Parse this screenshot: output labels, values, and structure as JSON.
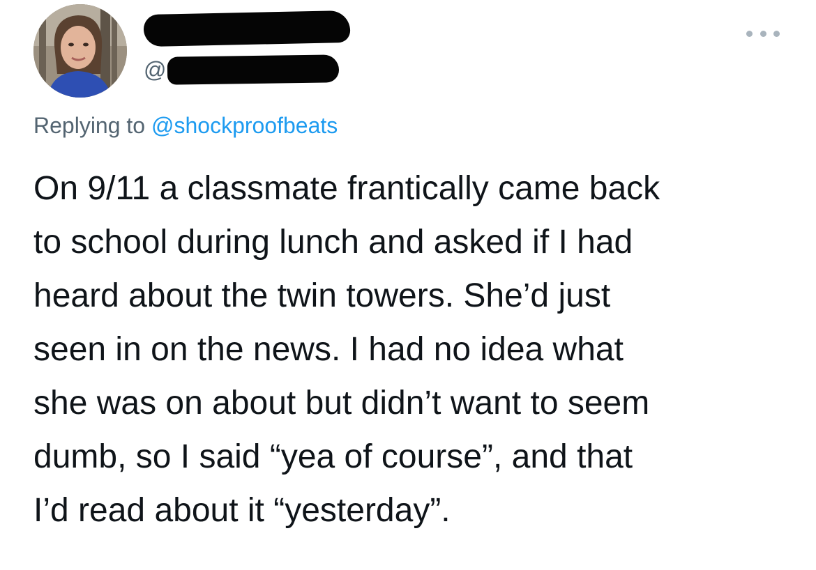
{
  "tweet": {
    "author": {
      "handle_prefix": "@",
      "avatar_icon": "profile-photo"
    },
    "more_icon": "ellipsis-icon",
    "reply_prefix": "Replying to",
    "reply_handle": "@shockproofbeats",
    "text_lines": [
      "On 9/11 a classmate frantically came back",
      "to school during lunch and asked if I had",
      "heard about the twin towers. She’d just",
      "seen in on the news. I had no idea what",
      "she was on about but didn’t want to seem",
      "dumb, so I said “yea of course”, and that",
      "I’d read about it “yesterday”."
    ],
    "colors": {
      "text": "#0f1419",
      "secondary": "#536471",
      "accent": "#1d9bf0"
    }
  }
}
